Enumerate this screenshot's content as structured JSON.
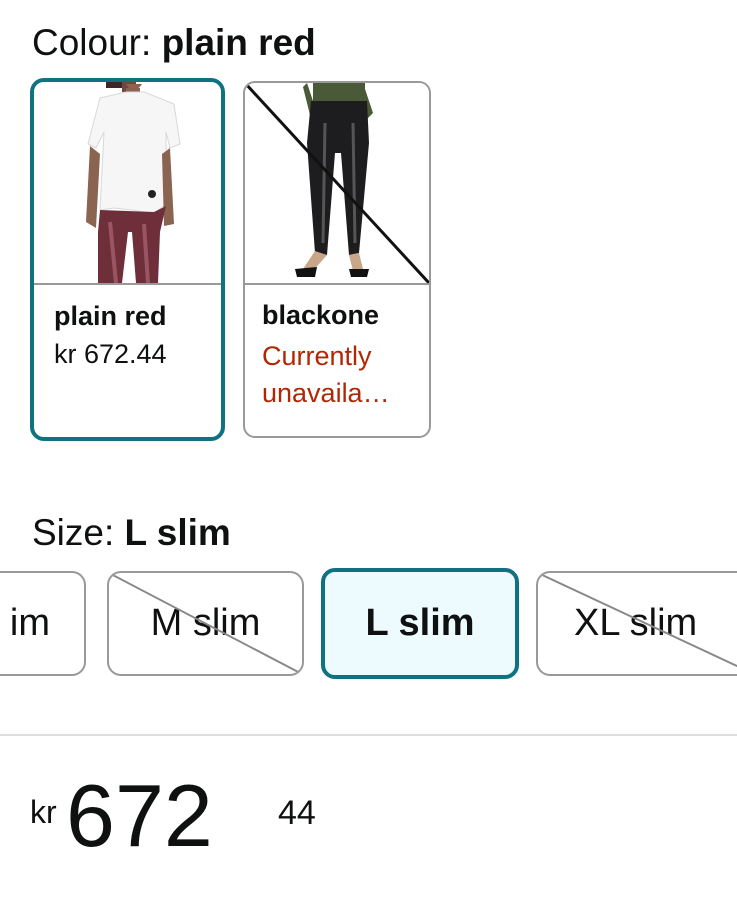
{
  "colour": {
    "label_key": "Colour: ",
    "label_value": "plain red",
    "swatches": [
      {
        "name": "plain red",
        "price": "kr 672.44",
        "selected": true,
        "available": true
      },
      {
        "name": "blackone",
        "availability": "Currently unavaila…",
        "selected": false,
        "available": false
      }
    ]
  },
  "size": {
    "label_key": "Size: ",
    "label_value": "L slim",
    "options": [
      {
        "label": "S slim",
        "shown": " im",
        "available": true,
        "selected": false
      },
      {
        "label": "M slim",
        "available": false,
        "selected": false
      },
      {
        "label": "L slim",
        "available": true,
        "selected": true
      },
      {
        "label": "XL slim",
        "available": false,
        "selected": false
      }
    ]
  },
  "price": {
    "currency": "kr",
    "whole": "672",
    "fraction": "44"
  },
  "colors": {
    "accent": "#0f7281",
    "selected_bg": "#edfbff",
    "unavailable": "#b12704",
    "border": "#999999"
  }
}
